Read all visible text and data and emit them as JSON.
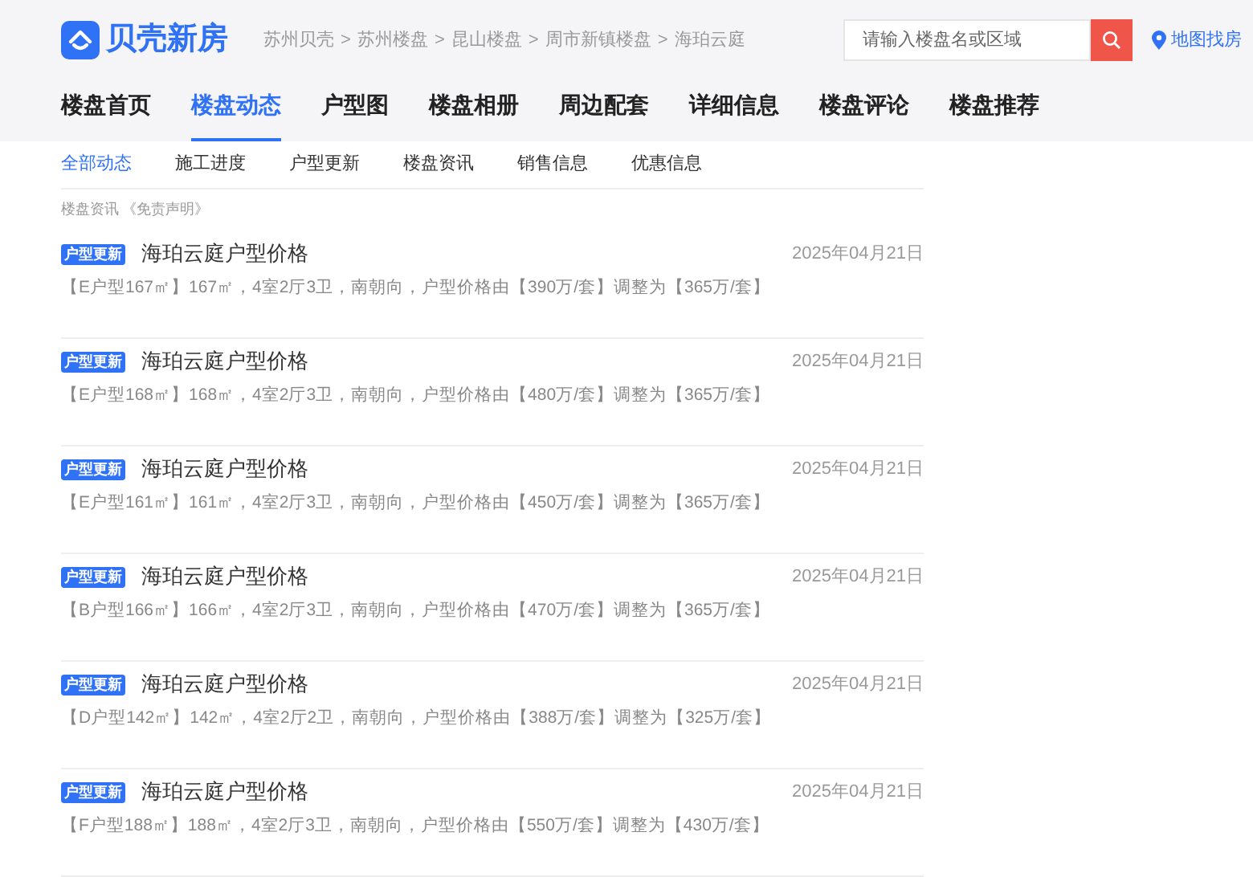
{
  "logo": {
    "text": "贝壳新房"
  },
  "breadcrumb": {
    "separator": ">",
    "items": [
      "苏州贝壳",
      "苏州楼盘",
      "昆山楼盘",
      "周市新镇楼盘",
      "海珀云庭"
    ]
  },
  "search": {
    "placeholder": "请输入楼盘名或区域"
  },
  "map_link": "地图找房",
  "nav_tabs": [
    {
      "label": "楼盘首页",
      "selected": false
    },
    {
      "label": "楼盘动态",
      "selected": true
    },
    {
      "label": "户型图",
      "selected": false
    },
    {
      "label": "楼盘相册",
      "selected": false
    },
    {
      "label": "周边配套",
      "selected": false
    },
    {
      "label": "详细信息",
      "selected": false
    },
    {
      "label": "楼盘评论",
      "selected": false
    },
    {
      "label": "楼盘推荐",
      "selected": false
    }
  ],
  "sub_tabs": [
    {
      "label": "全部动态",
      "selected": true
    },
    {
      "label": "施工进度",
      "selected": false
    },
    {
      "label": "户型更新",
      "selected": false
    },
    {
      "label": "楼盘资讯",
      "selected": false
    },
    {
      "label": "销售信息",
      "selected": false
    },
    {
      "label": "优惠信息",
      "selected": false
    }
  ],
  "disclaimer": {
    "label": "楼盘资讯",
    "link": "《免责声明》"
  },
  "news": [
    {
      "tag": "户型更新",
      "title": "海珀云庭户型价格",
      "date": "2025年04月21日",
      "desc": "【E户型167㎡】167㎡，4室2厅3卫，南朝向，户型价格由【390万/套】调整为【365万/套】"
    },
    {
      "tag": "户型更新",
      "title": "海珀云庭户型价格",
      "date": "2025年04月21日",
      "desc": "【E户型168㎡】168㎡，4室2厅3卫，南朝向，户型价格由【480万/套】调整为【365万/套】"
    },
    {
      "tag": "户型更新",
      "title": "海珀云庭户型价格",
      "date": "2025年04月21日",
      "desc": "【E户型161㎡】161㎡，4室2厅3卫，南朝向，户型价格由【450万/套】调整为【365万/套】"
    },
    {
      "tag": "户型更新",
      "title": "海珀云庭户型价格",
      "date": "2025年04月21日",
      "desc": "【B户型166㎡】166㎡，4室2厅3卫，南朝向，户型价格由【470万/套】调整为【365万/套】"
    },
    {
      "tag": "户型更新",
      "title": "海珀云庭户型价格",
      "date": "2025年04月21日",
      "desc": "【D户型142㎡】142㎡，4室2厅2卫，南朝向，户型价格由【388万/套】调整为【325万/套】"
    },
    {
      "tag": "户型更新",
      "title": "海珀云庭户型价格",
      "date": "2025年04月21日",
      "desc": "【F户型188㎡】188㎡，4室2厅3卫，南朝向，户型价格由【550万/套】调整为【430万/套】"
    }
  ]
}
